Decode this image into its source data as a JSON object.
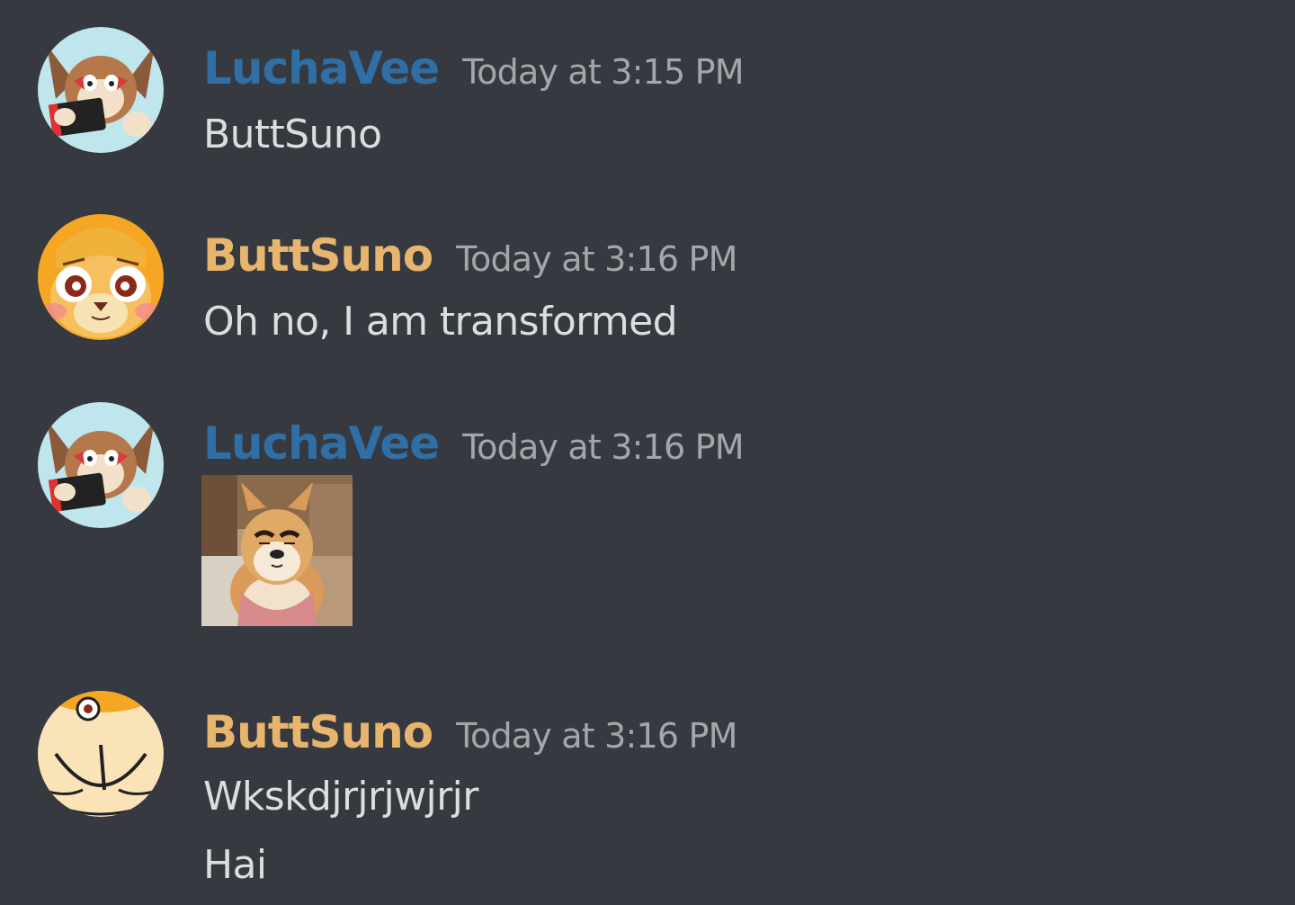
{
  "messages": [
    {
      "author": "LuchaVee",
      "author_color": "#2f6fa5",
      "timestamp": "Today at 3:15 PM",
      "avatar_icon": "luchavee-avatar",
      "lines": [
        "ButtSuno"
      ]
    },
    {
      "author": "ButtSuno",
      "author_color": "#e7b56d",
      "timestamp": "Today at 3:16 PM",
      "avatar_icon": "buttsuno-face-avatar",
      "lines": [
        "Oh no, I am transformed"
      ]
    },
    {
      "author": "LuchaVee",
      "author_color": "#2f6fa5",
      "timestamp": "Today at 3:16 PM",
      "avatar_icon": "luchavee-avatar",
      "attachment": "shiba-dog-eyebrows-image"
    },
    {
      "author": "ButtSuno",
      "author_color": "#e7b56d",
      "timestamp": "Today at 3:16 PM",
      "avatar_icon": "buttsuno-butt-avatar",
      "lines": [
        "Wkskdjrjrjwjrjr",
        "Hai"
      ]
    }
  ]
}
